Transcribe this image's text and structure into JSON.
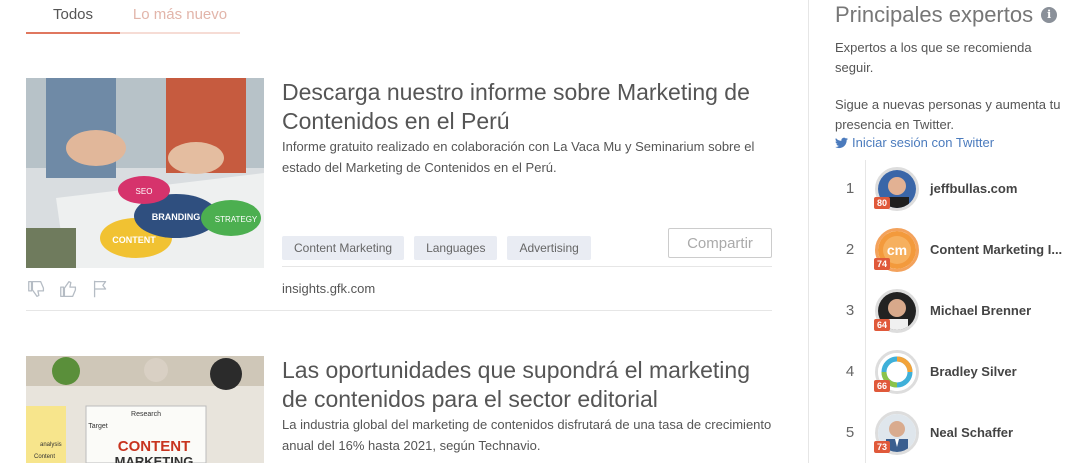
{
  "tabs": [
    {
      "label": "Todos",
      "active": true
    },
    {
      "label": "Lo más nuevo",
      "active": false
    }
  ],
  "articles": [
    {
      "title": "Descarga nuestro informe sobre Marketing de Contenidos en el Perú",
      "description": "Informe gratuito realizado en colaboración con La Vaca Mu y Seminarium sobre el estado del Marketing de Contenidos en el Perú.",
      "tags": [
        "Content Marketing",
        "Languages",
        "Advertising"
      ],
      "share_label": "Compartir",
      "source": "insights.gfk.com",
      "image_words": [
        "SEO",
        "BRANDING",
        "CONTENT",
        "STRATEGY"
      ]
    },
    {
      "title": "Las oportunidades que supondrá el marketing de contenidos para el sector editorial",
      "description": "La industria global del marketing de contenidos disfrutará de una tasa de crecimiento anual del 16% hasta 2021, según Technavio.",
      "image_words": [
        "Research",
        "Target",
        "CONTENT",
        "MARKETING",
        "analysis",
        "Content"
      ]
    }
  ],
  "sidebar": {
    "title": "Principales expertos",
    "info_icon": "i",
    "intro": "Expertos a los que se recomienda seguir.",
    "follow_text": "Sigue a nuevas personas y aumenta tu presencia en Twitter.",
    "twitter_link": "Iniciar sesión con Twitter",
    "experts": [
      {
        "rank": "1",
        "name": "jeffbullas.com",
        "score": "80"
      },
      {
        "rank": "2",
        "name": "Content Marketing I...",
        "score": "74"
      },
      {
        "rank": "3",
        "name": "Michael Brenner",
        "score": "64"
      },
      {
        "rank": "4",
        "name": "Bradley Silver",
        "score": "66"
      },
      {
        "rank": "5",
        "name": "Neal Schaffer",
        "score": "73"
      }
    ]
  },
  "colors": {
    "accent": "#e0775f",
    "tag_bg": "#e9ecf3",
    "link": "#4b7bbd",
    "score_badge": "#e0593a"
  }
}
